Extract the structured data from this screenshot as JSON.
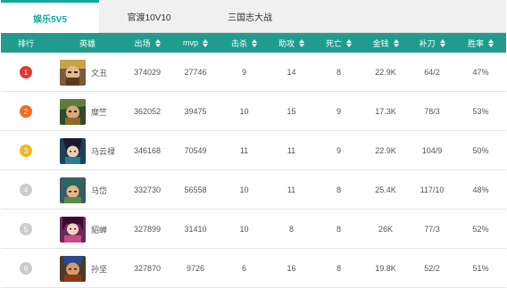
{
  "tabs": [
    {
      "label": "娱乐5V5",
      "active": true
    },
    {
      "label": "官渡10V10",
      "active": false
    },
    {
      "label": "三国志大战",
      "active": false
    }
  ],
  "columns": {
    "rank": "排行",
    "hero": "英雄",
    "games": "出场",
    "mvp": "mvp",
    "kill": "击杀",
    "assist": "助攻",
    "death": "死亡",
    "gold": "金钱",
    "cs": "补刀",
    "win": "胜率"
  },
  "colors": {
    "accent": "#13a89e",
    "header_bg": "#1f9c8e",
    "rank_1": "#e8362e",
    "rank_2": "#f26b21",
    "rank_3": "#f7b51d",
    "rank_other": "#cccccc"
  },
  "rows": [
    {
      "rank": "1",
      "hero": "文丑",
      "avatar_icon": "wen-chou-portrait-icon",
      "games": "374029",
      "mvp": "27746",
      "kill": "9",
      "assist": "14",
      "death": "8",
      "gold": "22.9K",
      "cs": "64/2",
      "win": "47%"
    },
    {
      "rank": "2",
      "hero": "糜竺",
      "avatar_icon": "mi-zhu-portrait-icon",
      "games": "362052",
      "mvp": "39475",
      "kill": "10",
      "assist": "15",
      "death": "9",
      "gold": "17.3K",
      "cs": "78/3",
      "win": "53%"
    },
    {
      "rank": "3",
      "hero": "马云禄",
      "avatar_icon": "ma-yunlu-portrait-icon",
      "games": "346168",
      "mvp": "70549",
      "kill": "11",
      "assist": "11",
      "death": "9",
      "gold": "22.9K",
      "cs": "104/9",
      "win": "50%"
    },
    {
      "rank": "4",
      "hero": "马岱",
      "avatar_icon": "ma-dai-portrait-icon",
      "games": "332730",
      "mvp": "56558",
      "kill": "10",
      "assist": "11",
      "death": "8",
      "gold": "25.4K",
      "cs": "117/10",
      "win": "48%"
    },
    {
      "rank": "5",
      "hero": "貂蝉",
      "avatar_icon": "diao-chan-portrait-icon",
      "games": "327899",
      "mvp": "31410",
      "kill": "10",
      "assist": "8",
      "death": "8",
      "gold": "26K",
      "cs": "77/3",
      "win": "52%"
    },
    {
      "rank": "6",
      "hero": "孙坚",
      "avatar_icon": "sun-jian-portrait-icon",
      "games": "327870",
      "mvp": "9726",
      "kill": "6",
      "assist": "16",
      "death": "8",
      "gold": "19.8K",
      "cs": "52/2",
      "win": "51%"
    }
  ]
}
